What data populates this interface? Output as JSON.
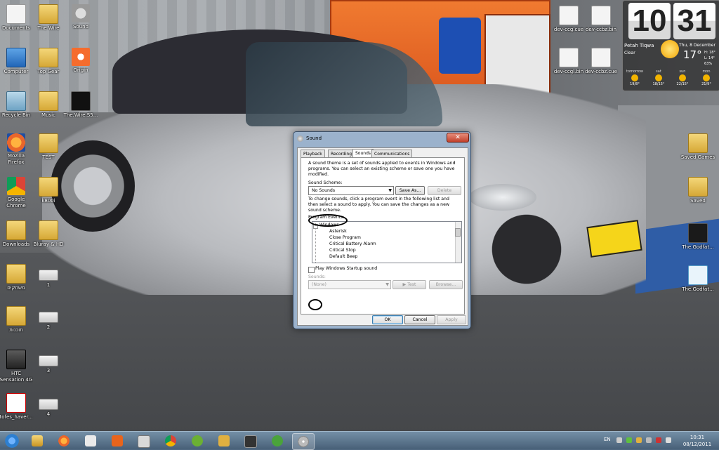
{
  "desktop_icons": [
    {
      "label": "Documents",
      "icon": "documents-icon"
    },
    {
      "label": "The Wire",
      "icon": "folder-icon"
    },
    {
      "label": "Sound",
      "icon": "speaker-icon"
    },
    {
      "label": "Computer",
      "icon": "computer-icon"
    },
    {
      "label": "Top Gear",
      "icon": "folder-icon"
    },
    {
      "label": "Origin",
      "icon": "origin-icon"
    },
    {
      "label": "Recycle Bin",
      "icon": "recycle-bin-icon"
    },
    {
      "label": "Music",
      "icon": "folder-icon"
    },
    {
      "label": "The.Wire.S5...",
      "icon": "hbo-video-icon"
    },
    {
      "label": "Mozilla Firefox",
      "icon": "firefox-icon"
    },
    {
      "label": "TEST",
      "icon": "folder-icon"
    },
    {
      "label": "Google Chrome",
      "icon": "chrome-icon"
    },
    {
      "label": "k800i",
      "icon": "folder-icon"
    },
    {
      "label": "Downloads",
      "icon": "downloads-folder-icon"
    },
    {
      "label": "Bluray & HD",
      "icon": "folder-icon"
    },
    {
      "label": "משחקים",
      "icon": "folder-icon"
    },
    {
      "label": "1",
      "icon": "webcam-icon"
    },
    {
      "label": "תוכנות",
      "icon": "folder-icon"
    },
    {
      "label": "2",
      "icon": "webcam-icon"
    },
    {
      "label": "HTC Sensation 4G",
      "icon": "phone-icon"
    },
    {
      "label": "3",
      "icon": "webcam-icon"
    },
    {
      "label": "tofes_haver...",
      "icon": "pdf-icon"
    },
    {
      "label": "4",
      "icon": "webcam-icon"
    },
    {
      "label": "dev-ccg.cue",
      "icon": "document-icon"
    },
    {
      "label": "dev-ccbz.bin",
      "icon": "document-icon"
    },
    {
      "label": "dev-ccgl.bin",
      "icon": "document-icon"
    },
    {
      "label": "dev-ccbz.cue",
      "icon": "document-icon"
    },
    {
      "label": "Saved Games",
      "icon": "folder-icon"
    },
    {
      "label": "Saved",
      "icon": "folder-icon"
    },
    {
      "label": "The.Godfat...",
      "icon": "video-file-icon"
    },
    {
      "label": "The.Godfat...",
      "icon": "shortcut-icon"
    }
  ],
  "weather": {
    "hour": "10",
    "minute": "31",
    "city": "Petah Tiqwa",
    "condition": "Clear",
    "date": "Thu, 8 December",
    "temp": "17°",
    "hi": "H: 18°",
    "lo": "L: 14°",
    "humidity": "63%",
    "forecast": [
      {
        "day": "tomorrow",
        "range": "19/8°"
      },
      {
        "day": "sat",
        "range": "18/15°"
      },
      {
        "day": "sun",
        "range": "22/15°"
      },
      {
        "day": "mon",
        "range": "21/9°"
      }
    ]
  },
  "dialog": {
    "title": "Sound",
    "close_label": "✕",
    "tabs": [
      "Playback",
      "Recording",
      "Sounds",
      "Communications"
    ],
    "intro": "A sound theme is a set of sounds applied to events in Windows and programs.  You can select an existing scheme or save one you have modified.",
    "scheme_label": "Sound Scheme:",
    "scheme_value": "No Sounds",
    "save_as": "Save As...",
    "delete": "Delete",
    "instructions": "To change sounds, click a program event in the following list and then select a sound to apply.  You can save the changes as a new sound scheme.",
    "events_label": "Program Events:",
    "events": [
      "Windows",
      "Asterisk",
      "Close Program",
      "Critical Battery Alarm",
      "Critical Stop",
      "Default Beep"
    ],
    "startup_label": "Play Windows Startup sound",
    "sounds_label": "Sounds:",
    "sounds_value": "(None)",
    "test": "▶ Test",
    "browse": "Browse...",
    "ok": "OK",
    "cancel": "Cancel",
    "apply": "Apply"
  },
  "taskbar": {
    "items": [
      "windows-explorer-icon",
      "firefox-icon",
      "media-player-icon",
      "mail-icon",
      "calendar-icon",
      "chrome-icon",
      "xbox-icon",
      "pen-icon",
      "speaker-icon",
      "utorrent-icon",
      "disc-icon"
    ],
    "active_index": 10,
    "language": "EN",
    "time": "10:31",
    "date": "08/12/2011"
  }
}
